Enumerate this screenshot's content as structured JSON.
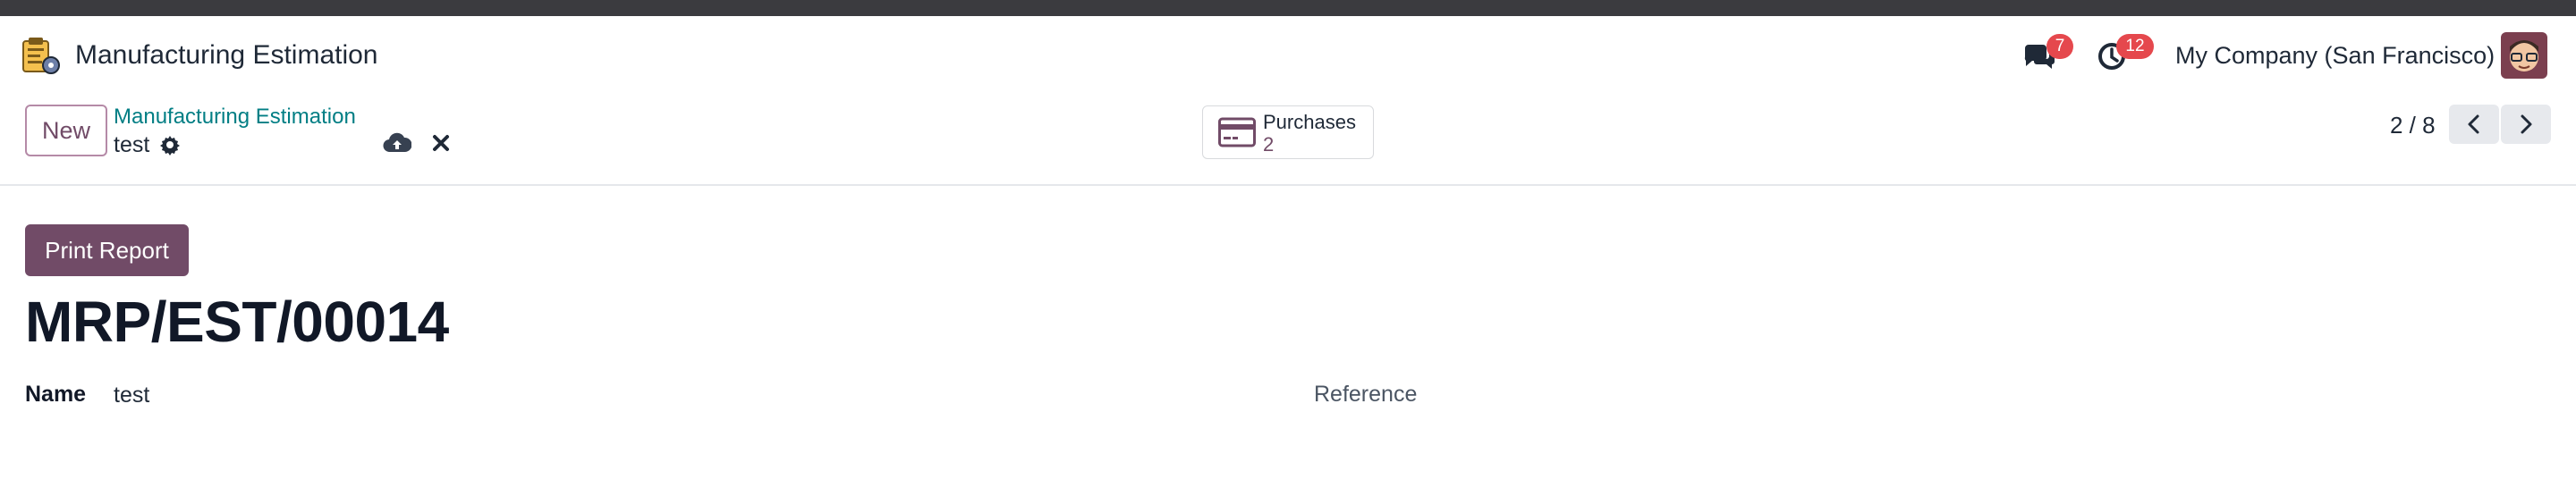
{
  "header": {
    "app_title": "Manufacturing Estimation",
    "messages_badge": "7",
    "activities_badge": "12",
    "company": "My Company (San Francisco)"
  },
  "control_panel": {
    "new_label": "New",
    "breadcrumb_parent": "Manufacturing Estimation",
    "breadcrumb_current": "test",
    "smart_button": {
      "label": "Purchases",
      "value": "2"
    },
    "pager": "2 / 8"
  },
  "form": {
    "print_label": "Print Report",
    "record_name": "MRP/EST/00014",
    "name_label": "Name",
    "name_value": "test",
    "reference_label": "Reference"
  },
  "colors": {
    "brand": "#714b67",
    "link": "#017e84",
    "badge": "#e5484d",
    "topstrip": "#3b3b3f"
  },
  "icons": [
    "app-icon",
    "chat-icon",
    "clock-icon",
    "avatar",
    "gear-icon",
    "cloud-upload-icon",
    "close-icon",
    "credit-card-icon",
    "chevron-left-icon",
    "chevron-right-icon"
  ]
}
